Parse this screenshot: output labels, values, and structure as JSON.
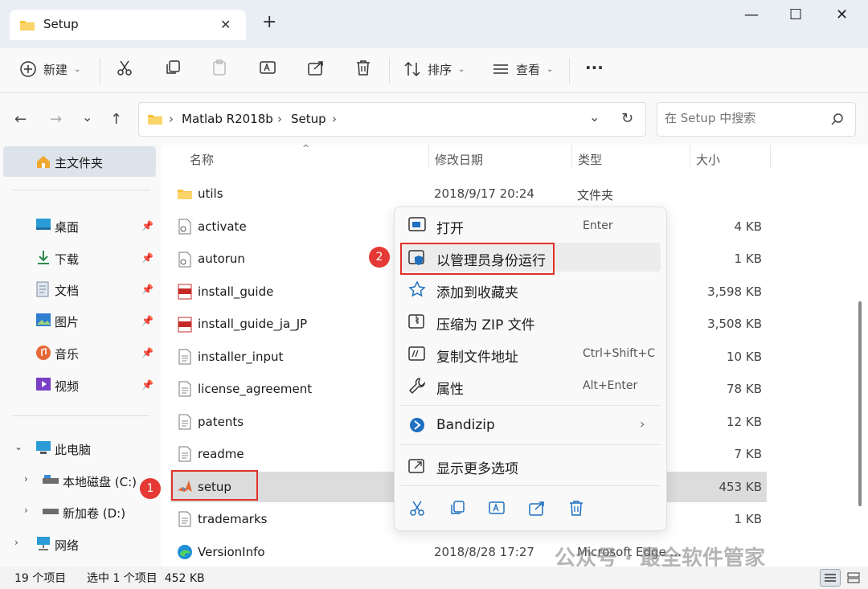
{
  "window": {
    "tab_title": "Setup",
    "tab_close": "✕",
    "new_tab": "+",
    "minimize": "—",
    "maximize": "☐",
    "close": "✕"
  },
  "toolbar": {
    "new_label": "新建",
    "sort_label": "排序",
    "view_label": "查看",
    "more_label": "···"
  },
  "breadcrumb": {
    "items": [
      "Matlab R2018b",
      "Setup"
    ],
    "separator": "›"
  },
  "search": {
    "placeholder": "在 Setup 中搜索"
  },
  "sidebar": {
    "home": "主文件夹",
    "quick": [
      "桌面",
      "下载",
      "文档",
      "图片",
      "音乐",
      "视频"
    ],
    "this_pc": "此电脑",
    "drives": [
      "本地磁盘 (C:)",
      "新加卷 (D:)"
    ],
    "network": "网络"
  },
  "columns": {
    "name": "名称",
    "date": "修改日期",
    "type": "类型",
    "size": "大小"
  },
  "files": [
    {
      "name": "utils",
      "date": "2018/9/17 20:24",
      "type": "文件夹",
      "size": ""
    },
    {
      "name": "activate",
      "date": "",
      "type": "",
      "size": "4 KB"
    },
    {
      "name": "autorun",
      "date": "",
      "type": "",
      "size": "1 KB"
    },
    {
      "name": "install_guide",
      "date": "",
      "type": "",
      "size": "3,598 KB"
    },
    {
      "name": "install_guide_ja_JP",
      "date": "",
      "type": "",
      "size": "3,508 KB"
    },
    {
      "name": "installer_input",
      "date": "",
      "type": "",
      "size": "10 KB"
    },
    {
      "name": "license_agreement",
      "date": "",
      "type": "",
      "size": "78 KB"
    },
    {
      "name": "patents",
      "date": "",
      "type": "",
      "size": "12 KB"
    },
    {
      "name": "readme",
      "date": "",
      "type": "",
      "size": "7 KB"
    },
    {
      "name": "setup",
      "date": "",
      "type": "",
      "size": "453 KB"
    },
    {
      "name": "trademarks",
      "date": "",
      "type": "",
      "size": "1 KB"
    },
    {
      "name": "VersionInfo",
      "date": "2018/8/28 17:27",
      "type": "Microsoft Edge ...",
      "size": ""
    }
  ],
  "context_menu": {
    "open": {
      "label": "打开",
      "shortcut": "Enter"
    },
    "run_as_admin": {
      "label": "以管理员身份运行"
    },
    "add_fav": {
      "label": "添加到收藏夹"
    },
    "zip": {
      "label": "压缩为 ZIP 文件"
    },
    "copy_path": {
      "label": "复制文件地址",
      "shortcut": "Ctrl+Shift+C"
    },
    "properties": {
      "label": "属性",
      "shortcut": "Alt+Enter"
    },
    "bandizip": {
      "label": "Bandizip"
    },
    "more": {
      "label": "显示更多选项"
    }
  },
  "status": {
    "count": "19 个项目",
    "selected": "选中 1 个项目  452 KB"
  },
  "badges": [
    "1",
    "2"
  ],
  "watermark": "公众号 · 最全软件管家",
  "colors": {
    "accent": "#0067c0",
    "highlight_red": "#e0312a",
    "selected_row": "#dcdcdc",
    "folder_yellow": "#f8c33b"
  }
}
